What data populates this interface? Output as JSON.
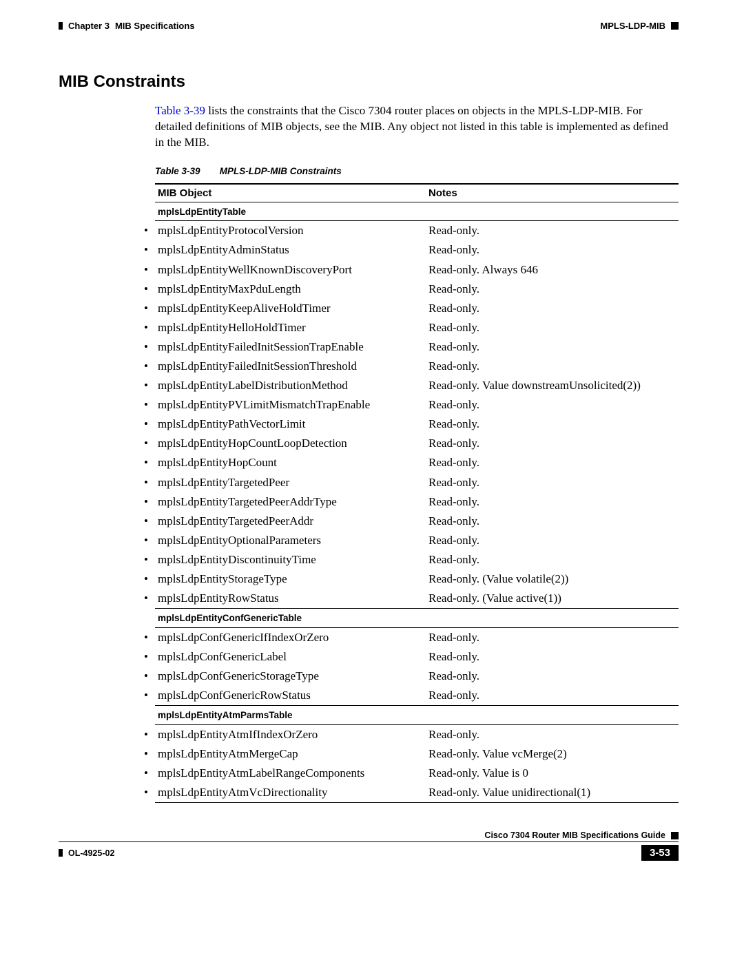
{
  "header": {
    "chapter": "Chapter 3",
    "chapter_title": "MIB Specifications",
    "section_label": "MPLS-LDP-MIB"
  },
  "section": {
    "title": "MIB Constraints",
    "intro_ref": "Table 3-39",
    "intro_rest": " lists the constraints that the Cisco 7304 router places on objects in the MPLS-LDP-MIB. For detailed definitions of MIB objects, see the MIB. Any object not listed in this table is implemented as defined in the MIB."
  },
  "table": {
    "number": "Table 3-39",
    "title": "MPLS-LDP-MIB Constraints",
    "head_obj": "MIB Object",
    "head_notes": "Notes",
    "groups": [
      {
        "name": "mplsLdpEntityTable",
        "rows": [
          {
            "obj": "mplsLdpEntityProtocolVersion",
            "notes": "Read-only."
          },
          {
            "obj": "mplsLdpEntityAdminStatus",
            "notes": "Read-only."
          },
          {
            "obj": "mplsLdpEntityWellKnownDiscoveryPort",
            "notes": "Read-only. Always 646"
          },
          {
            "obj": "mplsLdpEntityMaxPduLength",
            "notes": "Read-only."
          },
          {
            "obj": "mplsLdpEntityKeepAliveHoldTimer",
            "notes": "Read-only."
          },
          {
            "obj": "mplsLdpEntityHelloHoldTimer",
            "notes": "Read-only."
          },
          {
            "obj": "mplsLdpEntityFailedInitSessionTrapEnable",
            "notes": "Read-only."
          },
          {
            "obj": "mplsLdpEntityFailedInitSessionThreshold",
            "notes": "Read-only."
          },
          {
            "obj": "mplsLdpEntityLabelDistributionMethod",
            "notes": "Read-only. Value downstreamUnsolicited(2))"
          },
          {
            "obj": "mplsLdpEntityPVLimitMismatchTrapEnable",
            "notes": "Read-only."
          },
          {
            "obj": "mplsLdpEntityPathVectorLimit",
            "notes": "Read-only."
          },
          {
            "obj": "mplsLdpEntityHopCountLoopDetection",
            "notes": "Read-only."
          },
          {
            "obj": "mplsLdpEntityHopCount",
            "notes": "Read-only."
          },
          {
            "obj": "mplsLdpEntityTargetedPeer",
            "notes": "Read-only."
          },
          {
            "obj": "mplsLdpEntityTargetedPeerAddrType",
            "notes": "Read-only."
          },
          {
            "obj": "mplsLdpEntityTargetedPeerAddr",
            "notes": "Read-only."
          },
          {
            "obj": "mplsLdpEntityOptionalParameters",
            "notes": "Read-only."
          },
          {
            "obj": "mplsLdpEntityDiscontinuityTime",
            "notes": "Read-only."
          },
          {
            "obj": "mplsLdpEntityStorageType",
            "notes": "Read-only. (Value volatile(2))"
          },
          {
            "obj": "mplsLdpEntityRowStatus",
            "notes": "Read-only. (Value active(1))"
          }
        ]
      },
      {
        "name": "mplsLdpEntityConfGenericTable",
        "rows": [
          {
            "obj": "mplsLdpConfGenericIfIndexOrZero",
            "notes": "Read-only."
          },
          {
            "obj": "mplsLdpConfGenericLabel",
            "notes": "Read-only."
          },
          {
            "obj": "mplsLdpConfGenericStorageType",
            "notes": "Read-only."
          },
          {
            "obj": "mplsLdpConfGenericRowStatus",
            "notes": "Read-only."
          }
        ]
      },
      {
        "name": "mplsLdpEntityAtmParmsTable",
        "rows": [
          {
            "obj": "mplsLdpEntityAtmIfIndexOrZero",
            "notes": "Read-only."
          },
          {
            "obj": "mplsLdpEntityAtmMergeCap",
            "notes": "Read-only. Value vcMerge(2)"
          },
          {
            "obj": "mplsLdpEntityAtmLabelRangeComponents",
            "notes": "Read-only. Value is 0"
          },
          {
            "obj": "mplsLdpEntityAtmVcDirectionality",
            "notes": "Read-only. Value unidirectional(1)"
          }
        ]
      }
    ]
  },
  "footer": {
    "guide": "Cisco 7304 Router MIB Specifications Guide",
    "docnum": "OL-4925-02",
    "page": "3-53"
  }
}
